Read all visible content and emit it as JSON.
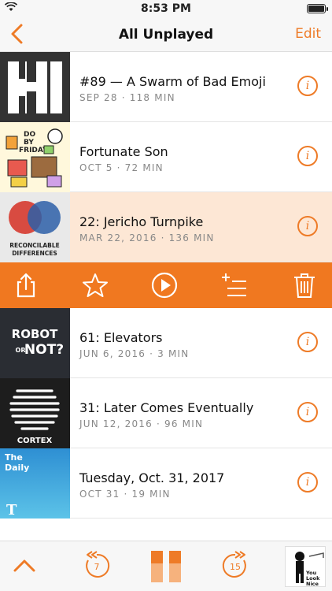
{
  "status_bar": {
    "time": "8:53 PM"
  },
  "nav": {
    "title": "All Unplayed",
    "edit_label": "Edit"
  },
  "episodes": [
    {
      "title": "#89 — A Swarm of Bad Emoji",
      "meta": "SEP 28 · 118 MIN",
      "art": "hi-logo",
      "art_text": "HI"
    },
    {
      "title": "Fortunate Son",
      "meta": "OCT 5 · 72 MIN",
      "art": "do-by-friday",
      "art_text": "DO BY FRIDAY"
    },
    {
      "title": "22: Jericho Turnpike",
      "meta": "MAR 22, 2016 · 136 MIN",
      "art": "reconcilable-differences",
      "art_text": "RECONCILABLE DIFFERENCES"
    },
    {
      "title": "61: Elevators",
      "meta": "JUN 6, 2016 · 3 MIN",
      "art": "robot-or-not",
      "art_text": "ROBOT OR NOT?"
    },
    {
      "title": "31: Later Comes Eventually",
      "meta": "JUN 12, 2016 · 96 MIN",
      "art": "cortex",
      "art_text": "CORTEX"
    },
    {
      "title": "Tuesday, Oct. 31, 2017",
      "meta": "OCT 31 · 19 MIN",
      "art": "the-daily",
      "art_text": "The Daily"
    }
  ],
  "action_bar": {
    "icons": [
      "share-icon",
      "star-icon",
      "play-icon",
      "add-to-queue-icon",
      "trash-icon"
    ]
  },
  "player": {
    "skip_back_seconds": "7",
    "skip_forward_seconds": "15",
    "now_playing_art_text": "You Look Nice Today."
  },
  "colors": {
    "accent": "#ee7b27",
    "action_bar": "#f07820",
    "selected_row": "#fde7d5"
  }
}
